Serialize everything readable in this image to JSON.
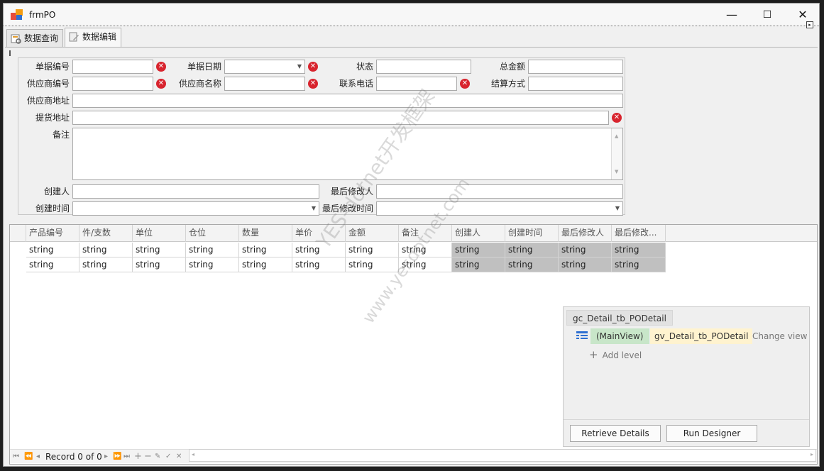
{
  "window": {
    "title": "frmPO",
    "minimize": "—",
    "maximize": "☐",
    "close": "✕"
  },
  "tabs": [
    {
      "label": "数据查询"
    },
    {
      "label": "数据编辑"
    }
  ],
  "form": {
    "bill_no_label": "单据编号",
    "bill_date_label": "单据日期",
    "status_label": "状态",
    "total_label": "总金额",
    "supplier_no_label": "供应商编号",
    "supplier_name_label": "供应商名称",
    "phone_label": "联系电话",
    "settle_label": "结算方式",
    "supplier_addr_label": "供应商地址",
    "pickup_addr_label": "提货地址",
    "remark_label": "备注",
    "creator_label": "创建人",
    "modifier_label": "最后修改人",
    "create_time_label": "创建时间",
    "modify_time_label": "最后修改时间"
  },
  "grid": {
    "columns": [
      "产品编号",
      "件/支数",
      "单位",
      "仓位",
      "数量",
      "单价",
      "金额",
      "备注",
      "创建人",
      "创建时间",
      "最后修改人",
      "最后修改..."
    ],
    "rows": [
      [
        "string",
        "string",
        "string",
        "string",
        "string",
        "string",
        "string",
        "string",
        "string",
        "string",
        "string",
        "string"
      ],
      [
        "string",
        "string",
        "string",
        "string",
        "string",
        "string",
        "string",
        "string",
        "string",
        "string",
        "string",
        "string"
      ]
    ]
  },
  "designer": {
    "title": "gc_Detail_tb_PODetail",
    "main_view": "(MainView)",
    "view_name": "gv_Detail_tb_PODetail",
    "change_view": "Change view",
    "add_level": "Add level",
    "retrieve_button": "Retrieve Details",
    "run_designer_button": "Run Designer"
  },
  "navigator": {
    "record_text": "Record 0 of 0"
  },
  "watermark": {
    "line1": "YES-dotnet开发框架",
    "line2": "www.yesdotnet.com"
  },
  "colors": {
    "clear_icon": "#d8242e",
    "readonly_cell": "#c0c0c0",
    "main_view_bg": "#c8e6c9",
    "view_bg": "#fff3cf"
  }
}
